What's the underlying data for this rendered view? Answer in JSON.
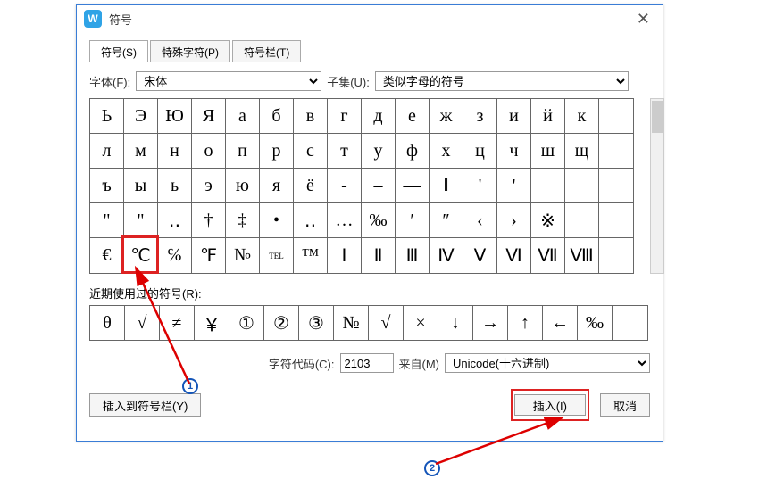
{
  "title": "符号",
  "tabs": [
    "符号(S)",
    "特殊字符(P)",
    "符号栏(T)"
  ],
  "font_label": "字体(F):",
  "font_value": "宋体",
  "subset_label": "子集(U):",
  "subset_value": "类似字母的符号",
  "grid": [
    [
      "Ь",
      "Э",
      "Ю",
      "Я",
      "а",
      "б",
      "в",
      "г",
      "д",
      "е",
      "ж",
      "з",
      "и",
      "й",
      "к",
      ""
    ],
    [
      "л",
      "м",
      "н",
      "о",
      "п",
      "р",
      "с",
      "т",
      "у",
      "ф",
      "х",
      "ц",
      "ч",
      "ш",
      "щ",
      ""
    ],
    [
      "ъ",
      "ы",
      "ь",
      "э",
      "ю",
      "я",
      "ё",
      "-",
      "–",
      "—",
      "‖",
      "'",
      "'",
      "",
      "",
      " "
    ],
    [
      "\"",
      "\"",
      "‥",
      "†",
      "‡",
      "•",
      "‥",
      "…",
      "‰",
      "′",
      "″",
      "‹",
      "›",
      "※",
      "",
      ""
    ],
    [
      "€",
      "℃",
      "℅",
      "℉",
      "№",
      "℡",
      "™",
      "Ⅰ",
      "Ⅱ",
      "Ⅲ",
      "Ⅳ",
      "Ⅴ",
      "Ⅵ",
      "Ⅶ",
      "Ⅷ",
      ""
    ]
  ],
  "recent_label": "近期使用过的符号(R):",
  "recent": [
    "θ",
    "√",
    "≠",
    "￥",
    "①",
    "②",
    "③",
    "№",
    "√",
    "×",
    "↓",
    "→",
    "↑",
    "←",
    "‰",
    ""
  ],
  "code_label": "字符代码(C):",
  "code_value": "2103",
  "from_label": "来自(M)",
  "from_value": "Unicode(十六进制)",
  "bottom": {
    "insert_bar": "插入到符号栏(Y)",
    "insert": "插入(I)",
    "cancel": "取消"
  },
  "badges": {
    "one": "1",
    "two": "2"
  }
}
